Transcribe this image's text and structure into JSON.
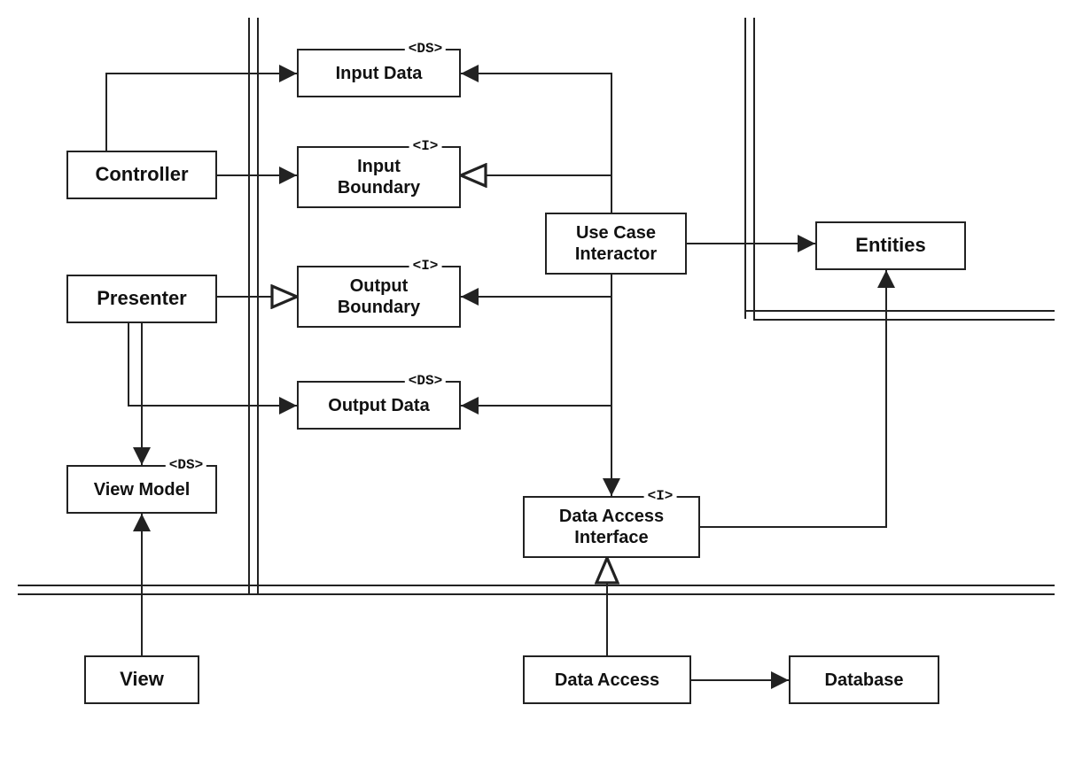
{
  "boxes": {
    "controller": {
      "label": "Controller"
    },
    "presenter": {
      "label": "Presenter"
    },
    "view_model": {
      "label": "View Model",
      "stereotype": "<DS>"
    },
    "view": {
      "label": "View"
    },
    "input_data": {
      "label": "Input Data",
      "stereotype": "<DS>"
    },
    "input_boundary": {
      "label": "Input\nBoundary",
      "stereotype": "<I>"
    },
    "output_boundary": {
      "label": "Output\nBoundary",
      "stereotype": "<I>"
    },
    "output_data": {
      "label": "Output Data",
      "stereotype": "<DS>"
    },
    "use_case": {
      "label": "Use Case\nInteractor"
    },
    "data_access_interface": {
      "label": "Data Access\nInterface",
      "stereotype": "<I>"
    },
    "entities": {
      "label": "Entities"
    },
    "data_access": {
      "label": "Data Access"
    },
    "database": {
      "label": "Database"
    }
  },
  "diagram": {
    "relationships": [
      {
        "from": "controller",
        "to": "input_data",
        "type": "uses",
        "arrow": "solid"
      },
      {
        "from": "controller",
        "to": "input_boundary",
        "type": "uses",
        "arrow": "solid"
      },
      {
        "from": "presenter",
        "to": "output_boundary",
        "type": "implements",
        "arrow": "open-triangle"
      },
      {
        "from": "presenter",
        "to": "output_data",
        "type": "uses",
        "arrow": "solid"
      },
      {
        "from": "presenter",
        "to": "view_model",
        "type": "uses",
        "arrow": "solid"
      },
      {
        "from": "view",
        "to": "view_model",
        "type": "uses",
        "arrow": "solid"
      },
      {
        "from": "use_case",
        "to": "input_data",
        "type": "uses",
        "arrow": "solid"
      },
      {
        "from": "use_case",
        "to": "input_boundary",
        "type": "implements",
        "arrow": "open-triangle"
      },
      {
        "from": "use_case",
        "to": "output_boundary",
        "type": "uses",
        "arrow": "solid"
      },
      {
        "from": "use_case",
        "to": "output_data",
        "type": "uses",
        "arrow": "solid"
      },
      {
        "from": "use_case",
        "to": "entities",
        "type": "uses",
        "arrow": "solid"
      },
      {
        "from": "use_case",
        "to": "data_access_interface",
        "type": "uses",
        "arrow": "solid"
      },
      {
        "from": "data_access",
        "to": "data_access_interface",
        "type": "implements",
        "arrow": "open-triangle"
      },
      {
        "from": "data_access",
        "to": "entities",
        "type": "uses",
        "arrow": "solid"
      },
      {
        "from": "data_access",
        "to": "database",
        "type": "uses",
        "arrow": "solid"
      }
    ],
    "boundaries": [
      "left-vertical-double-line",
      "right-vertical-double-line",
      "horizontal-double-line"
    ]
  }
}
